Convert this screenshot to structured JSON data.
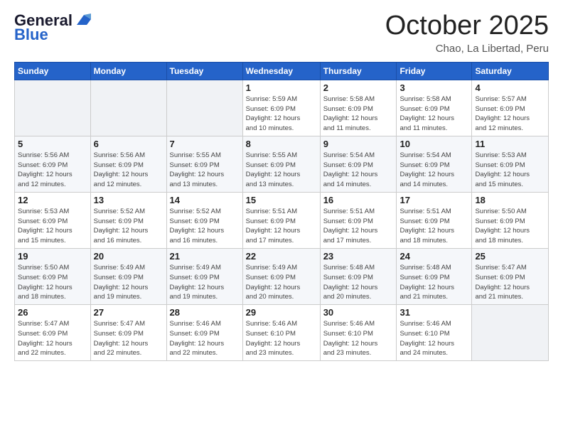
{
  "logo": {
    "text_general": "General",
    "text_blue": "Blue"
  },
  "header": {
    "month": "October 2025",
    "location": "Chao, La Libertad, Peru"
  },
  "days_of_week": [
    "Sunday",
    "Monday",
    "Tuesday",
    "Wednesday",
    "Thursday",
    "Friday",
    "Saturday"
  ],
  "weeks": [
    {
      "days": [
        {
          "num": "",
          "info": ""
        },
        {
          "num": "",
          "info": ""
        },
        {
          "num": "",
          "info": ""
        },
        {
          "num": "1",
          "info": "Sunrise: 5:59 AM\nSunset: 6:09 PM\nDaylight: 12 hours\nand 10 minutes."
        },
        {
          "num": "2",
          "info": "Sunrise: 5:58 AM\nSunset: 6:09 PM\nDaylight: 12 hours\nand 11 minutes."
        },
        {
          "num": "3",
          "info": "Sunrise: 5:58 AM\nSunset: 6:09 PM\nDaylight: 12 hours\nand 11 minutes."
        },
        {
          "num": "4",
          "info": "Sunrise: 5:57 AM\nSunset: 6:09 PM\nDaylight: 12 hours\nand 12 minutes."
        }
      ]
    },
    {
      "days": [
        {
          "num": "5",
          "info": "Sunrise: 5:56 AM\nSunset: 6:09 PM\nDaylight: 12 hours\nand 12 minutes."
        },
        {
          "num": "6",
          "info": "Sunrise: 5:56 AM\nSunset: 6:09 PM\nDaylight: 12 hours\nand 12 minutes."
        },
        {
          "num": "7",
          "info": "Sunrise: 5:55 AM\nSunset: 6:09 PM\nDaylight: 12 hours\nand 13 minutes."
        },
        {
          "num": "8",
          "info": "Sunrise: 5:55 AM\nSunset: 6:09 PM\nDaylight: 12 hours\nand 13 minutes."
        },
        {
          "num": "9",
          "info": "Sunrise: 5:54 AM\nSunset: 6:09 PM\nDaylight: 12 hours\nand 14 minutes."
        },
        {
          "num": "10",
          "info": "Sunrise: 5:54 AM\nSunset: 6:09 PM\nDaylight: 12 hours\nand 14 minutes."
        },
        {
          "num": "11",
          "info": "Sunrise: 5:53 AM\nSunset: 6:09 PM\nDaylight: 12 hours\nand 15 minutes."
        }
      ]
    },
    {
      "days": [
        {
          "num": "12",
          "info": "Sunrise: 5:53 AM\nSunset: 6:09 PM\nDaylight: 12 hours\nand 15 minutes."
        },
        {
          "num": "13",
          "info": "Sunrise: 5:52 AM\nSunset: 6:09 PM\nDaylight: 12 hours\nand 16 minutes."
        },
        {
          "num": "14",
          "info": "Sunrise: 5:52 AM\nSunset: 6:09 PM\nDaylight: 12 hours\nand 16 minutes."
        },
        {
          "num": "15",
          "info": "Sunrise: 5:51 AM\nSunset: 6:09 PM\nDaylight: 12 hours\nand 17 minutes."
        },
        {
          "num": "16",
          "info": "Sunrise: 5:51 AM\nSunset: 6:09 PM\nDaylight: 12 hours\nand 17 minutes."
        },
        {
          "num": "17",
          "info": "Sunrise: 5:51 AM\nSunset: 6:09 PM\nDaylight: 12 hours\nand 18 minutes."
        },
        {
          "num": "18",
          "info": "Sunrise: 5:50 AM\nSunset: 6:09 PM\nDaylight: 12 hours\nand 18 minutes."
        }
      ]
    },
    {
      "days": [
        {
          "num": "19",
          "info": "Sunrise: 5:50 AM\nSunset: 6:09 PM\nDaylight: 12 hours\nand 18 minutes."
        },
        {
          "num": "20",
          "info": "Sunrise: 5:49 AM\nSunset: 6:09 PM\nDaylight: 12 hours\nand 19 minutes."
        },
        {
          "num": "21",
          "info": "Sunrise: 5:49 AM\nSunset: 6:09 PM\nDaylight: 12 hours\nand 19 minutes."
        },
        {
          "num": "22",
          "info": "Sunrise: 5:49 AM\nSunset: 6:09 PM\nDaylight: 12 hours\nand 20 minutes."
        },
        {
          "num": "23",
          "info": "Sunrise: 5:48 AM\nSunset: 6:09 PM\nDaylight: 12 hours\nand 20 minutes."
        },
        {
          "num": "24",
          "info": "Sunrise: 5:48 AM\nSunset: 6:09 PM\nDaylight: 12 hours\nand 21 minutes."
        },
        {
          "num": "25",
          "info": "Sunrise: 5:47 AM\nSunset: 6:09 PM\nDaylight: 12 hours\nand 21 minutes."
        }
      ]
    },
    {
      "days": [
        {
          "num": "26",
          "info": "Sunrise: 5:47 AM\nSunset: 6:09 PM\nDaylight: 12 hours\nand 22 minutes."
        },
        {
          "num": "27",
          "info": "Sunrise: 5:47 AM\nSunset: 6:09 PM\nDaylight: 12 hours\nand 22 minutes."
        },
        {
          "num": "28",
          "info": "Sunrise: 5:46 AM\nSunset: 6:09 PM\nDaylight: 12 hours\nand 22 minutes."
        },
        {
          "num": "29",
          "info": "Sunrise: 5:46 AM\nSunset: 6:10 PM\nDaylight: 12 hours\nand 23 minutes."
        },
        {
          "num": "30",
          "info": "Sunrise: 5:46 AM\nSunset: 6:10 PM\nDaylight: 12 hours\nand 23 minutes."
        },
        {
          "num": "31",
          "info": "Sunrise: 5:46 AM\nSunset: 6:10 PM\nDaylight: 12 hours\nand 24 minutes."
        },
        {
          "num": "",
          "info": ""
        }
      ]
    }
  ]
}
